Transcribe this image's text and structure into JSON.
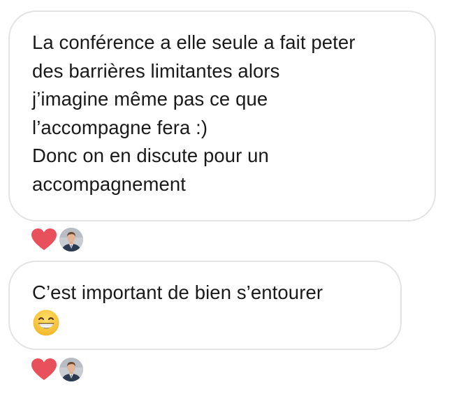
{
  "messages": [
    {
      "lines": [
        "La conférence a elle seule a fait peter",
        "des barrières limitantes alors",
        "j’imagine même pas ce que",
        "l’accompagne fera :)",
        "Donc on en discute pour un",
        "accompagnement"
      ],
      "reactions": {
        "emoji": "heart-icon",
        "reactor": "avatar"
      }
    },
    {
      "lines": [
        "C’est important de bien s’entourer"
      ],
      "trailing_emoji": "grinning-face-with-smiling-eyes-icon",
      "reactions": {
        "emoji": "heart-icon",
        "reactor": "avatar"
      }
    }
  ],
  "colors": {
    "heart": "#e8505b",
    "bubble_border": "#e3e3e3",
    "text": "#1a1a1a",
    "emoji_face": "#f7c23a"
  }
}
